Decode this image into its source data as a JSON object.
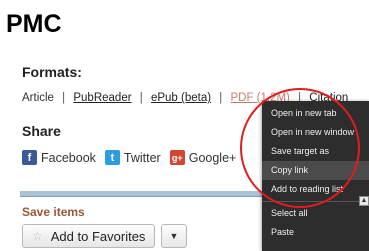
{
  "brand": "PMC",
  "formats": {
    "title": "Formats:",
    "items": [
      "Article",
      "PubReader",
      "ePub (beta)",
      "PDF (1.2M)",
      "Citation"
    ],
    "separator": "|"
  },
  "share": {
    "title": "Share",
    "items": [
      {
        "label": "Facebook",
        "icon": "facebook-icon",
        "glyph": "f",
        "color": "#3b5998"
      },
      {
        "label": "Twitter",
        "icon": "twitter-icon",
        "glyph": "t",
        "color": "#2b9de0"
      },
      {
        "label": "Google+",
        "icon": "google-plus-icon",
        "glyph": "g+",
        "color": "#d24532"
      }
    ]
  },
  "save_items": {
    "title": "Save items",
    "add_favorites_label": "Add to Favorites",
    "star_icon": "☆",
    "dropdown_glyph": "▼"
  },
  "context_menu": {
    "items": [
      {
        "label": "Open in new tab",
        "selected": false
      },
      {
        "label": "Open in new window",
        "selected": false
      },
      {
        "label": "Save target as",
        "selected": false
      },
      {
        "label": "Copy link",
        "selected": true
      },
      {
        "label": "Add to reading list",
        "selected": false
      },
      {
        "separator": true
      },
      {
        "label": "Select all",
        "selected": false
      },
      {
        "label": "Paste",
        "selected": false
      }
    ]
  },
  "scroll_up_glyph": "▲",
  "colors": {
    "highlight_ring": "#e31b1b",
    "save_title": "#985735",
    "menu_bg": "#2d2d2d"
  }
}
